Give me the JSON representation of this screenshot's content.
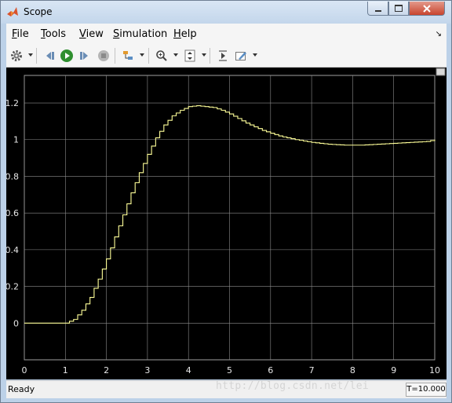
{
  "window": {
    "title": "Scope"
  },
  "menu": {
    "items": [
      {
        "key": "F",
        "rest": "ile"
      },
      {
        "key": "T",
        "rest": "ools"
      },
      {
        "key": "V",
        "rest": "iew"
      },
      {
        "key": "S",
        "rest": "imulation"
      },
      {
        "key": "H",
        "rest": "elp"
      }
    ]
  },
  "toolbar": {
    "icons": [
      "gear-icon",
      "step-back-icon",
      "run-icon",
      "step-forward-icon",
      "stop-icon",
      "highlight-icon",
      "zoom-icon",
      "autoscale-icon",
      "cursor-measure-icon",
      "edit-icon"
    ]
  },
  "colors": {
    "trace": "#ffff99",
    "plot_background": "#000000",
    "grid": "#8c8c8c",
    "tick_label": "#e6e6e6"
  },
  "chart_data": {
    "type": "line",
    "xlim": [
      0,
      10
    ],
    "ylim": [
      -0.2,
      1.35
    ],
    "xticks": [
      "0",
      "1",
      "2",
      "3",
      "4",
      "5",
      "6",
      "7",
      "8",
      "9",
      "10"
    ],
    "yticks": [
      "0",
      "0.2",
      "0.4",
      "0.6",
      "0.8",
      "1",
      "1.2"
    ],
    "grid": true,
    "x": [
      0,
      1.0,
      1.2,
      1.4,
      1.6,
      1.8,
      2.0,
      2.2,
      2.4,
      2.6,
      2.8,
      3.0,
      3.2,
      3.4,
      3.6,
      3.8,
      4.0,
      4.2,
      4.4,
      4.6,
      4.8,
      5.0,
      5.4,
      5.8,
      6.2,
      6.6,
      7.0,
      7.4,
      7.8,
      8.2,
      8.6,
      9.0,
      9.4,
      9.8,
      10.0
    ],
    "y": [
      0,
      0,
      0.02,
      0.07,
      0.14,
      0.24,
      0.35,
      0.47,
      0.59,
      0.71,
      0.82,
      0.92,
      1.01,
      1.08,
      1.13,
      1.16,
      1.18,
      1.185,
      1.18,
      1.175,
      1.16,
      1.14,
      1.09,
      1.05,
      1.02,
      1.0,
      0.985,
      0.975,
      0.97,
      0.97,
      0.975,
      0.98,
      0.985,
      0.99,
      1.0
    ]
  },
  "status": {
    "text": "Ready",
    "time": "T=10.000"
  },
  "watermark": "http://blog.csdn.net/lei"
}
